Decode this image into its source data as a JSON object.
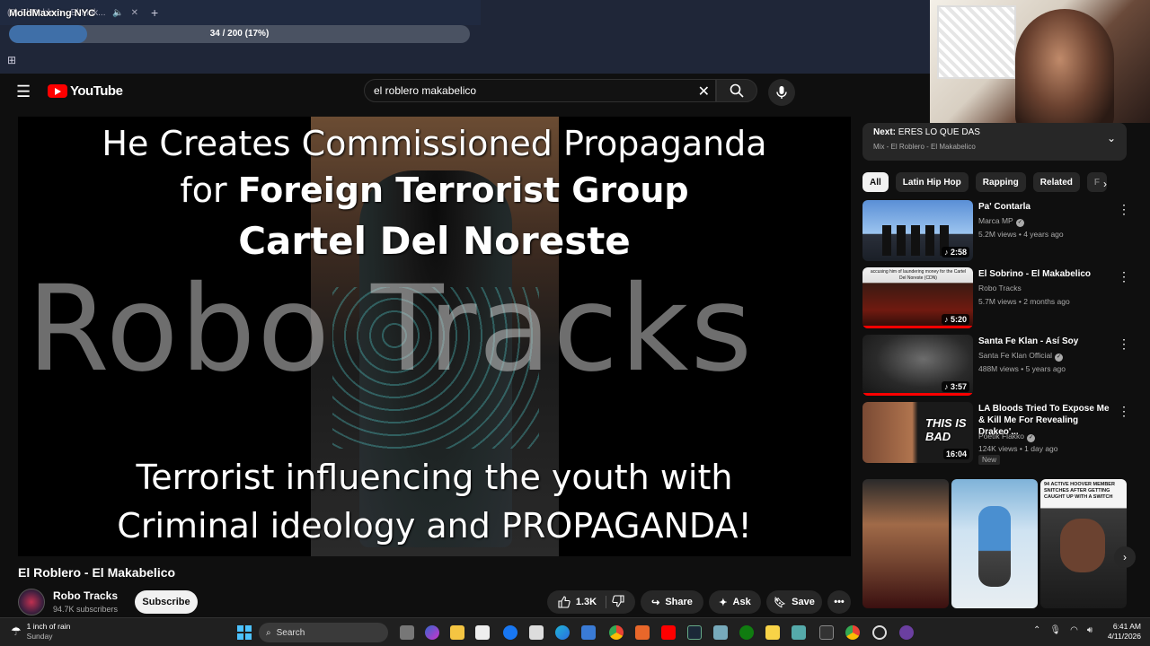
{
  "browser": {
    "tab_title": "(2) El Roblero - El Mak...",
    "new_tab_symbol": "+",
    "overlay_title": "MoldMaxxing NYC",
    "progress_text": "34 / 200 (17%)",
    "progress_fraction": 0.17
  },
  "header": {
    "logo_text": "YouTube",
    "search_value": "el roblero makabelico"
  },
  "video": {
    "line1": "He Creates Commissioned Propaganda",
    "line2_prefix": "for ",
    "line2_bold": "Foreign Terrorist Group",
    "line3": "Cartel Del Noreste",
    "watermark": "Robo Tracks",
    "line4": "Terrorist influencing the youth with",
    "line5": "Criminal ideology and PROPAGANDA!"
  },
  "below_video": {
    "title": "El Roblero - El Makabelico",
    "channel_name": "Robo Tracks",
    "channel_subs": "94.7K subscribers",
    "subscribe_label": "Subscribe",
    "like_count": "1.3K",
    "share_label": "Share",
    "ask_label": "Ask",
    "save_label": "Save"
  },
  "sidebar": {
    "next_prefix": "Next: ",
    "next_title": "ERES LO QUE DAS",
    "next_sub": "Mix - El Roblero - El Makabelico",
    "chips": [
      "All",
      "Latin Hip Hop",
      "Rapping",
      "Related",
      "F"
    ],
    "recs": [
      {
        "title": "Pa' Contarla",
        "channel": "Marca MP",
        "meta": "5.2M views • 4 years ago",
        "duration": "2:58"
      },
      {
        "title": "El Sobrino - El Makabelico",
        "channel": "Robo Tracks",
        "meta": "5.7M views • 2 months ago",
        "duration": "5:20"
      },
      {
        "title": "Santa Fe Klan - Así Soy",
        "channel": "Santa Fe Klan Official",
        "meta": "488M views • 5 years ago",
        "duration": "3:57"
      },
      {
        "title": "LA Bloods Tried To Expose Me & Kill Me For Revealing Drakeo'...",
        "channel": "Poetik Flakko",
        "meta": "124K views • 1 day ago",
        "duration": "16:04",
        "badge": "New",
        "thumb_text": "THIS IS BAD"
      }
    ],
    "rec2_thumb_caption": "accusing him of laundering money for the Cartel Del Noreste (CDN)",
    "short3_caption": "94 ACTIVE HOOVER MEMBER SNITCHES AFTER GETTING CAUGHT UP WITH A SWITCH"
  },
  "taskbar": {
    "weather_line1": "1 inch of rain",
    "weather_line2": "Sunday",
    "search_label": "Search",
    "time": "6:41 AM",
    "date": "4/11/2026"
  }
}
